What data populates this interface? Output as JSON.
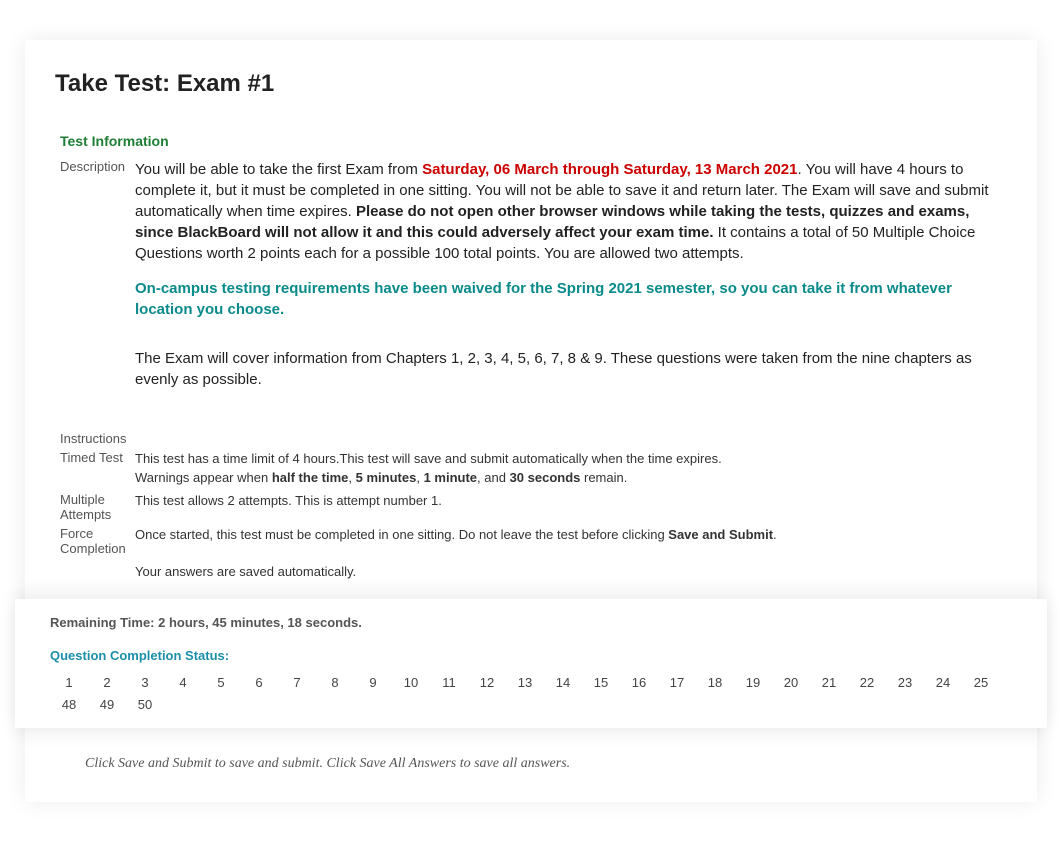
{
  "pageTitle": "Take Test: Exam #1",
  "testInfo": {
    "header": "Test Information",
    "descriptionLabel": "Description",
    "desc_p1_a": "You will be able to take the first Exam from ",
    "desc_p1_dates": "Saturday, 06 March through Saturday, 13 March 2021",
    "desc_p1_b": ".  You will have 4 hours to complete it, but it must be completed in one sitting. You will not be able to save it and return later. The Exam will save and submit automatically when time expires.   ",
    "desc_p1_bold": "Please do not open other browser windows while taking the tests, quizzes and exams, since BlackBoard will not allow it and this could adversely affect your exam time.",
    "desc_p1_c": "  It contains a total of 50 Multiple Choice Questions worth 2 points each for a possible 100 total points.  You are allowed two attempts.",
    "desc_p2_teal": "On-campus testing requirements have been waived for the Spring 2021 semester, so you can take it from whatever location you choose.",
    "desc_p3": "The Exam will cover information from Chapters 1, 2, 3, 4, 5, 6, 7, 8 & 9.  These questions were taken from the nine chapters as evenly as possible.",
    "instructionsLabel": "Instructions",
    "instructionsValue": "",
    "timedTestLabel": "Timed Test",
    "timedTest_a": "This test has a time limit of 4 hours.This test will save and submit automatically when the time expires.",
    "timedTest_b1": "Warnings appear when ",
    "timedTest_half": "half the time",
    "timedTest_b2": ", ",
    "timedTest_5min": "5 minutes",
    "timedTest_b3": ", ",
    "timedTest_1min": "1 minute",
    "timedTest_b4": ", and ",
    "timedTest_30sec": "30 seconds",
    "timedTest_b5": " remain.",
    "multipleAttemptsLabel": "Multiple Attempts",
    "multipleAttemptsValue": "This test allows 2 attempts. This is attempt number 1.",
    "forceCompletionLabel": "Force Completion",
    "forceCompletion_a": "Once started, this test must be completed in one sitting. Do not leave the test before clicking ",
    "forceCompletion_bold": "Save and Submit",
    "forceCompletion_b": ".",
    "autosave": "Your answers are saved automatically."
  },
  "stickyPanel": {
    "remainingTime": "Remaining Time: 2 hours, 45 minutes, 18 seconds.",
    "qcsLabel": "Question Completion Status:",
    "questions": [
      "1",
      "2",
      "3",
      "4",
      "5",
      "6",
      "7",
      "8",
      "9",
      "10",
      "11",
      "12",
      "13",
      "14",
      "15",
      "16",
      "17",
      "18",
      "19",
      "20",
      "21",
      "22",
      "23",
      "24",
      "25",
      "48",
      "49",
      "50"
    ]
  },
  "footerNote": "Click Save and Submit to save and submit. Click Save All Answers to save all answers."
}
